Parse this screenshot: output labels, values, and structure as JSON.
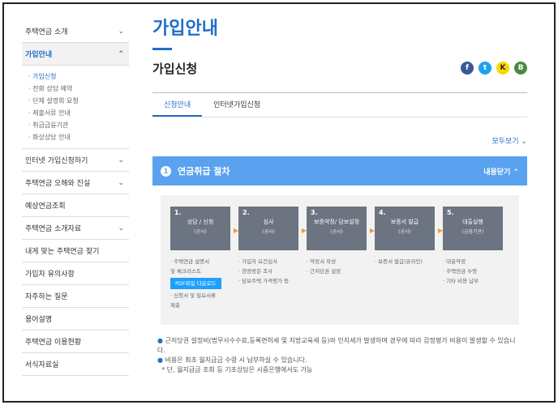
{
  "sidebar": {
    "items_top": [
      {
        "label": "주택연금 소개",
        "chevron": "⌄"
      },
      {
        "label": "가입안내",
        "chevron": "⌃"
      }
    ],
    "subitems": [
      "가입신청",
      "전화 상담 예약",
      "단체 설명회 요청",
      "제출서류 안내",
      "취급금융기관",
      "화상상담 안내"
    ],
    "items_bottom": [
      {
        "label": "인터넷 가입신청하기",
        "chevron": "⌄"
      },
      {
        "label": "주택연금 오해와 진실",
        "chevron": "⌄"
      },
      {
        "label": "예상연금조회",
        "chevron": ""
      },
      {
        "label": "주택연금 소개자료",
        "chevron": "⌄"
      },
      {
        "label": "내게 맞는 주택연금 찾기",
        "chevron": ""
      },
      {
        "label": "가입자 유의사항",
        "chevron": ""
      },
      {
        "label": "자주하는 질문",
        "chevron": ""
      },
      {
        "label": "용어설명",
        "chevron": ""
      },
      {
        "label": "주택연금 이용현황",
        "chevron": ""
      },
      {
        "label": "서식자료실",
        "chevron": ""
      }
    ]
  },
  "main": {
    "title": "가입안내",
    "subtitle": "가입신청",
    "social": [
      "f",
      "t",
      "K",
      "B"
    ],
    "tabs": [
      "신청안내",
      "인터넷가입신청"
    ],
    "expand_all": "모두보기 ⌄",
    "accordion": {
      "num": "1",
      "title": "연금취급 절차",
      "toggle": "내용닫기 ⌃"
    },
    "steps": [
      {
        "num": "1.",
        "title": "상담 / 신청",
        "sub": "(공사)",
        "lines": [
          "· 주택연금 설명서",
          "및 체크리스트"
        ],
        "button": "PDF파일 다운로드",
        "lines2": [
          "· 신청서 및 필요서류",
          "제출"
        ]
      },
      {
        "num": "2.",
        "title": "심사",
        "sub": "(공사)",
        "lines": [
          "· 가입자 요건심사",
          "· 현장방문 조사",
          "· 담보주택 가격평가 등"
        ]
      },
      {
        "num": "3.",
        "title": "보증약정/ 담보설정",
        "sub": "(공사)",
        "lines": [
          "· 약정서 작성",
          "· 근저당권 설정"
        ]
      },
      {
        "num": "4.",
        "title": "보증서 발급",
        "sub": "(공사)",
        "lines": [
          "· 보증서 발급(온라인)"
        ]
      },
      {
        "num": "5.",
        "title": "대출실행",
        "sub": "(금융기관)",
        "lines": [
          "· 대출약정",
          "· 주택연금 수령",
          "· 기타 비용 납부"
        ]
      }
    ],
    "notes": [
      "근저당권 설정비(법무사수수료,등록면허세 및 지방교육세 등)와 인지세가 발생하며 경우에 따라 감정평가 비용이 발생할 수 있습니다.",
      "비용은 최초 월지급금 수령 시 납부하실 수 있습니다.",
      "* 단, 월지급금 조회 등 기초상담은 시중은행에서도 가능"
    ]
  },
  "colors": {
    "accent": "#1e6fc9",
    "accordion": "#5aa2ef",
    "step": "#6b7480",
    "arrow": "#f39c2a"
  }
}
